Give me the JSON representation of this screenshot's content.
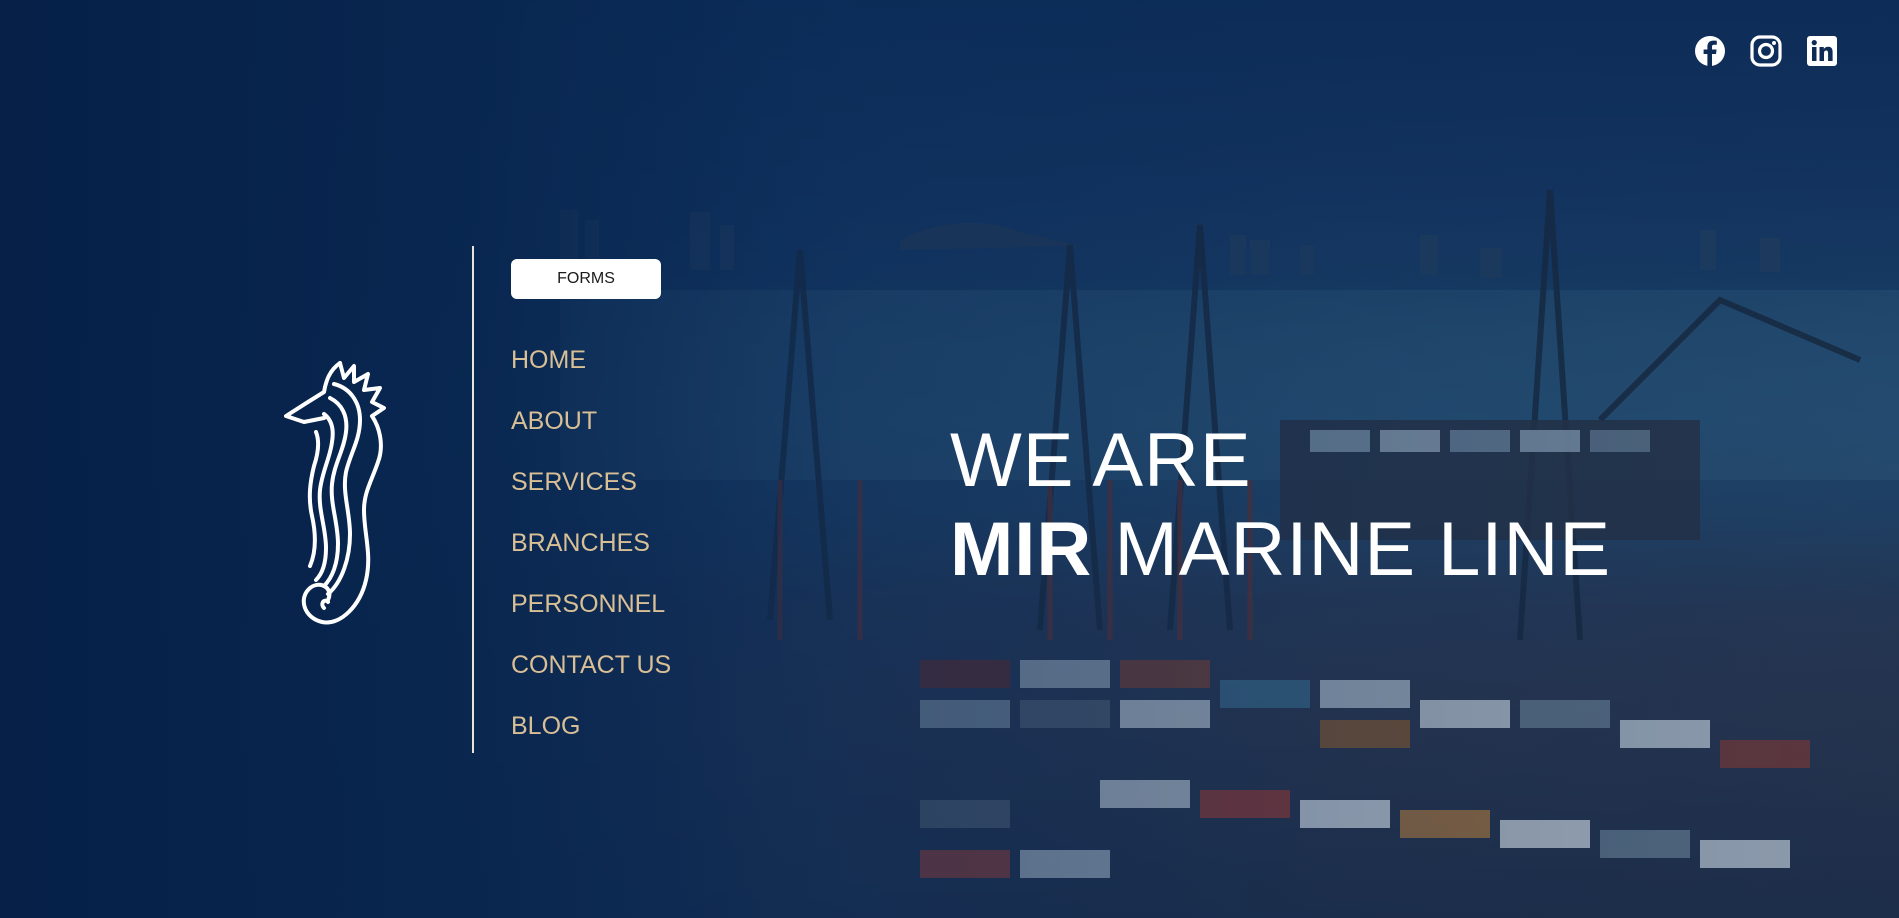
{
  "social": {
    "icons": [
      "facebook-icon",
      "instagram-icon",
      "linkedin-icon"
    ]
  },
  "logo": {
    "icon": "seahorse-icon"
  },
  "forms_button": {
    "label": "FORMS"
  },
  "nav": {
    "items": [
      {
        "label": "HOME"
      },
      {
        "label": "ABOUT"
      },
      {
        "label": "SERVICES"
      },
      {
        "label": "BRANCHES"
      },
      {
        "label": "PERSONNEL"
      },
      {
        "label": "CONTACT US"
      },
      {
        "label": "BLOG"
      }
    ]
  },
  "hero": {
    "line1": "WE ARE",
    "line2_bold": "MIR",
    "line2_rest": "MARINE LINE"
  },
  "colors": {
    "nav_text": "#d9bf95",
    "overlay": "#0a2a55",
    "headline": "#ffffff"
  }
}
